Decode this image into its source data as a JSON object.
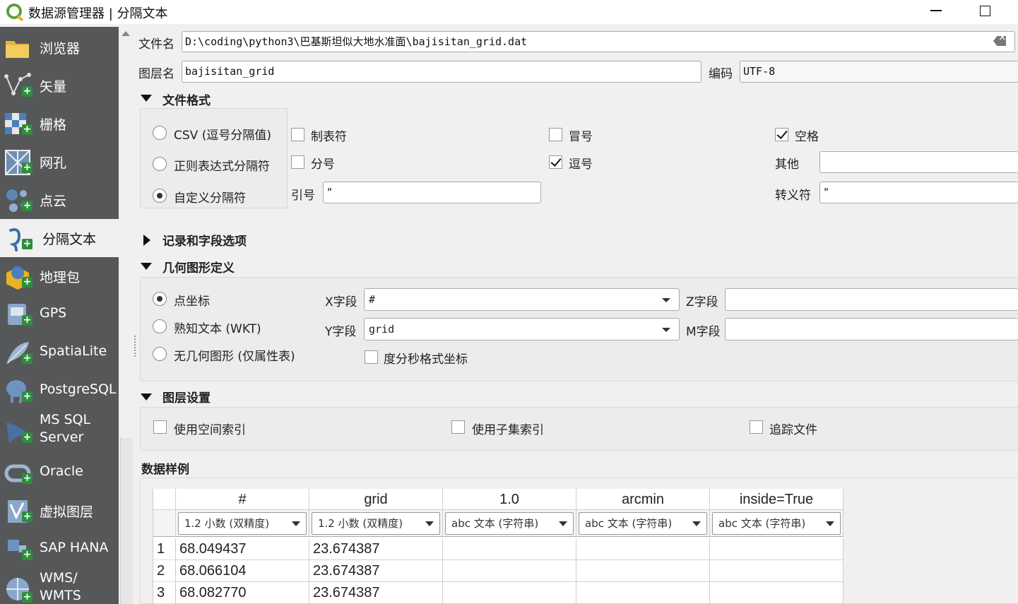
{
  "window": {
    "title": "数据源管理器 | 分隔文本"
  },
  "sidebar": {
    "items": [
      {
        "label": "浏览器",
        "icon": "folder-icon"
      },
      {
        "label": "矢量",
        "icon": "vector-icon"
      },
      {
        "label": "栅格",
        "icon": "raster-icon"
      },
      {
        "label": "网孔",
        "icon": "mesh-icon"
      },
      {
        "label": "点云",
        "icon": "point-cloud-icon"
      },
      {
        "label": "分隔文本",
        "icon": "delimited-text-icon",
        "active": true
      },
      {
        "label": "地理包",
        "icon": "geopackage-icon"
      },
      {
        "label": "GPS",
        "icon": "gps-icon"
      },
      {
        "label": "SpatiaLite",
        "icon": "spatialite-icon"
      },
      {
        "label": "PostgreSQL",
        "icon": "postgresql-icon"
      },
      {
        "label": "MS SQL Server",
        "icon": "mssql-icon"
      },
      {
        "label": "Oracle",
        "icon": "oracle-icon"
      },
      {
        "label": "虚拟图层",
        "icon": "virtual-layer-icon"
      },
      {
        "label": "SAP HANA",
        "icon": "sap-hana-icon"
      },
      {
        "label": "WMS/ WMTS",
        "icon": "wms-icon"
      }
    ]
  },
  "file": {
    "label": "文件名",
    "value": "D:\\coding\\python3\\巴基斯坦似大地水准面\\bajisitan_grid.dat"
  },
  "layer": {
    "label": "图层名",
    "value": "bajisitan_grid",
    "encoding_label": "编码",
    "encoding_value": "UTF-8"
  },
  "file_format": {
    "header": "文件格式",
    "radios": [
      {
        "label": "CSV (逗号分隔值)",
        "checked": false
      },
      {
        "label": "正则表达式分隔符",
        "checked": false
      },
      {
        "label": "自定义分隔符",
        "checked": true
      }
    ],
    "delimiters": {
      "tab": {
        "label": "制表符",
        "checked": false
      },
      "colon": {
        "label": "冒号",
        "checked": false
      },
      "space": {
        "label": "空格",
        "checked": true
      },
      "semicolon": {
        "label": "分号",
        "checked": false
      },
      "comma": {
        "label": "逗号",
        "checked": true
      }
    },
    "other_label": "其他",
    "other_value": "",
    "quote_label": "引号",
    "quote_value": "\"",
    "escape_label": "转义符",
    "escape_value": "\""
  },
  "record_options": {
    "header": "记录和字段选项"
  },
  "geometry": {
    "header": "几何图形定义",
    "radios": [
      {
        "label": "点坐标",
        "checked": true
      },
      {
        "label": "熟知文本 (WKT)",
        "checked": false
      },
      {
        "label": "无几何图形 (仅属性表)",
        "checked": false
      }
    ],
    "x_label": "X字段",
    "x_value": "#",
    "y_label": "Y字段",
    "y_value": "grid",
    "z_label": "Z字段",
    "z_value": "",
    "m_label": "M字段",
    "m_value": "",
    "dms_label": "度分秒格式坐标",
    "dms_checked": false
  },
  "layer_settings": {
    "header": "图层设置",
    "spatial_index": {
      "label": "使用空间索引",
      "checked": false
    },
    "subset_index": {
      "label": "使用子集索引",
      "checked": false
    },
    "watch_file": {
      "label": "追踪文件",
      "checked": false
    }
  },
  "sample": {
    "header": "数据样例",
    "columns": [
      "#",
      "grid",
      "1.0",
      "arcmin",
      "inside=True"
    ],
    "types": [
      "1.2 小数 (双精度)",
      "1.2 小数 (双精度)",
      "abc 文本 (字符串)",
      "abc 文本 (字符串)",
      "abc 文本 (字符串)"
    ],
    "rows": [
      {
        "n": "1",
        "cells": [
          "68.049437",
          "23.674387",
          "",
          "",
          ""
        ]
      },
      {
        "n": "2",
        "cells": [
          "68.066104",
          "23.674387",
          "",
          "",
          ""
        ]
      },
      {
        "n": "3",
        "cells": [
          "68.082770",
          "23.674387",
          "",
          "",
          ""
        ]
      }
    ]
  }
}
